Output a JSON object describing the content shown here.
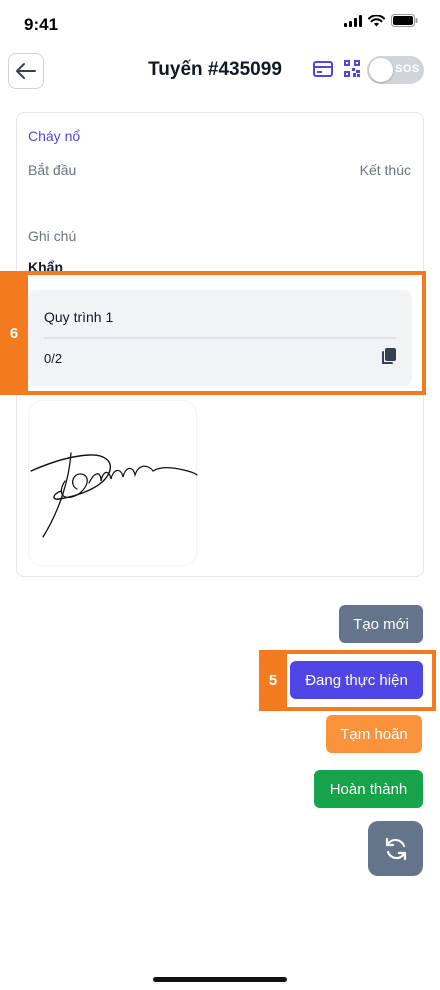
{
  "status_bar": {
    "time": "9:41"
  },
  "header": {
    "title": "Tuyến #435099",
    "sos_label": "SOS"
  },
  "incident": {
    "type": "Cháy nổ",
    "start_label": "Bắt đầu",
    "end_label": "Kết thúc",
    "note_label": "Ghi chú",
    "note_value": "Khẩn"
  },
  "process": {
    "name": "Quy trình 1",
    "progress": "0/2"
  },
  "badges": {
    "process": "6",
    "in_progress": "5"
  },
  "actions": {
    "new_label": "Tạo mới",
    "in_progress_label": "Đang thực hiện",
    "pause_label": "Tạm hoãn",
    "done_label": "Hoàn thành"
  },
  "colors": {
    "accent": "#4f46e5",
    "highlight": "#f47a20",
    "new": "#64748b",
    "pause": "#fb923c",
    "done": "#16a34a"
  }
}
